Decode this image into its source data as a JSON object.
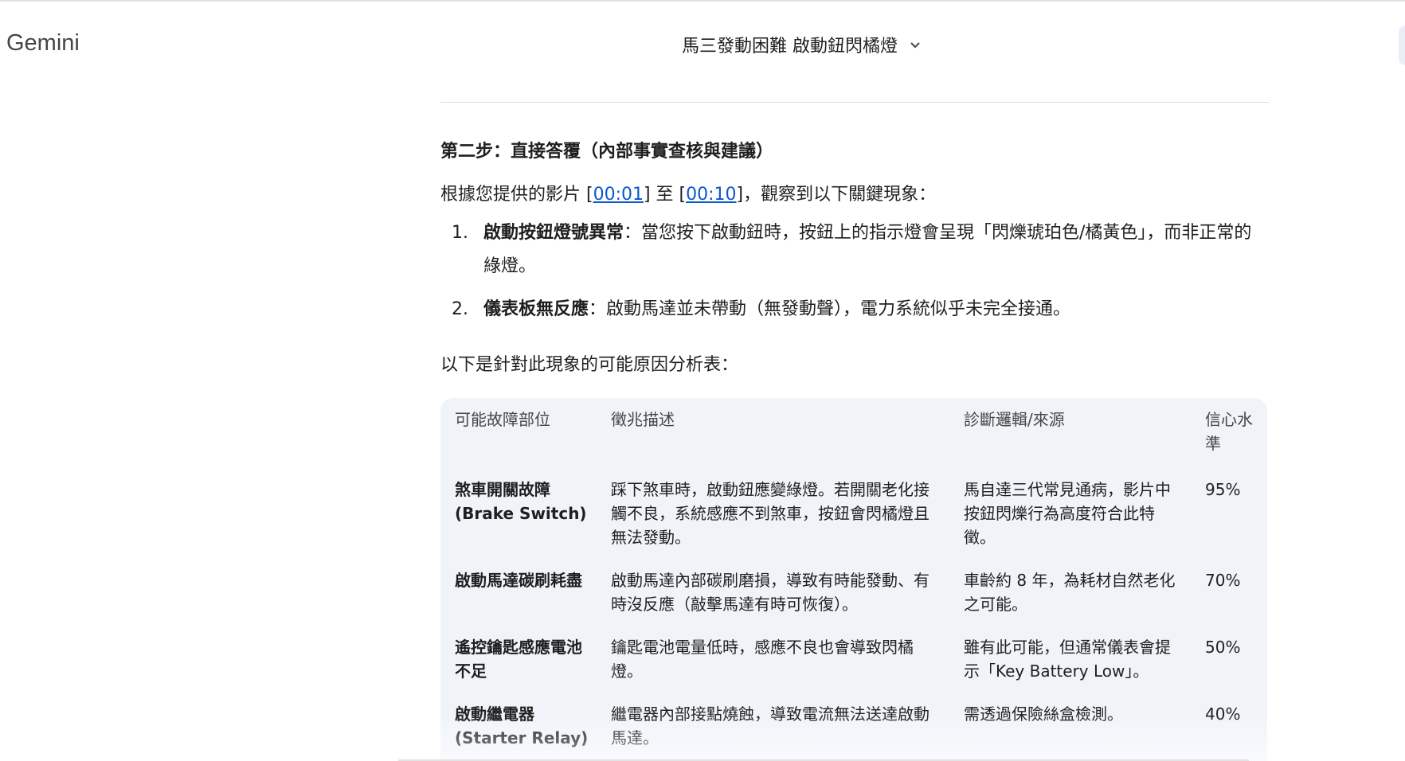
{
  "app": {
    "name": "Gemini"
  },
  "header": {
    "conversation_title": "馬三發動困難 啟動鈕閃橘燈"
  },
  "message": {
    "heading": "第二步：直接答覆（內部事實查核與建議）",
    "intro": {
      "before": "根據您提供的影片 [",
      "link1": "00:01",
      "middle": "] 至 [",
      "link2": "00:10",
      "after": "]，觀察到以下關鍵現象："
    },
    "list": [
      {
        "num": "1.",
        "title": "啟動按鈕燈號異常",
        "text": "：當您按下啟動鈕時，按鈕上的指示燈會呈現「閃爍琥珀色/橘黃色」，而非正常的綠燈。"
      },
      {
        "num": "2.",
        "title": "儀表板無反應",
        "text": "：啟動馬達並未帶動（無發動聲），電力系統似乎未完全接通。"
      }
    ],
    "table_intro": "以下是針對此現象的可能原因分析表：",
    "table": {
      "headers": [
        "可能故障部位",
        "徵兆描述",
        "診斷邏輯/來源",
        "信心水準"
      ],
      "rows": [
        [
          "煞車開關故障 (Brake Switch)",
          "踩下煞車時，啟動鈕應變綠燈。若開關老化接觸不良，系統感應不到煞車，按鈕會閃橘燈且無法發動。",
          "馬自達三代常見通病，影片中按鈕閃爍行為高度符合此特徵。",
          "95%"
        ],
        [
          "啟動馬達碳刷耗盡",
          "啟動馬達內部碳刷磨損，導致有時能發動、有時沒反應（敲擊馬達有時可恢復）。",
          "車齡約 8 年，為耗材自然老化之可能。",
          "70%"
        ],
        [
          "遙控鑰匙感應電池不足",
          "鑰匙電池電量低時，感應不良也會導致閃橘燈。",
          "雖有此可能，但通常儀表會提示「Key Battery Low」。",
          "50%"
        ],
        [
          "啟動繼電器 (Starter Relay)",
          "繼電器內部接點燒蝕，導致電流無法送達啟動馬達。",
          "需透過保險絲盒檢測。",
          "40%"
        ]
      ]
    }
  }
}
